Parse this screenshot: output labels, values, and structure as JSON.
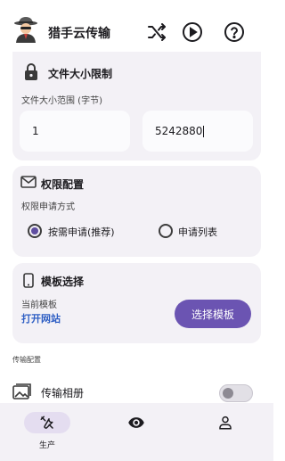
{
  "app": {
    "title": "猎手云传输"
  },
  "size_card": {
    "title": "文件大小限制",
    "range_label": "文件大小范围 (字节)",
    "min_value": "1",
    "max_value": "5242880"
  },
  "perm_card": {
    "title": "权限配置",
    "method_label": "权限申请方式",
    "options": [
      {
        "label": "按需申请(推荐)",
        "selected": true
      },
      {
        "label": "申请列表",
        "selected": false
      }
    ]
  },
  "template_card": {
    "title": "模板选择",
    "current_label": "当前模板",
    "current_value": "打开网站",
    "choose_button": "选择模板"
  },
  "transfer": {
    "section_label": "传输配置",
    "album_label": "传输相册",
    "album_enabled": false
  },
  "bottom_nav": {
    "items": [
      {
        "label": "生产",
        "icon": "tools-icon",
        "active": true
      },
      {
        "label": "",
        "icon": "eye-icon",
        "active": false
      },
      {
        "label": "",
        "icon": "person-icon",
        "active": false
      }
    ]
  },
  "colors": {
    "accent": "#6b54b2",
    "link": "#2f5fc4",
    "card_bg": "#f3f1f6"
  }
}
